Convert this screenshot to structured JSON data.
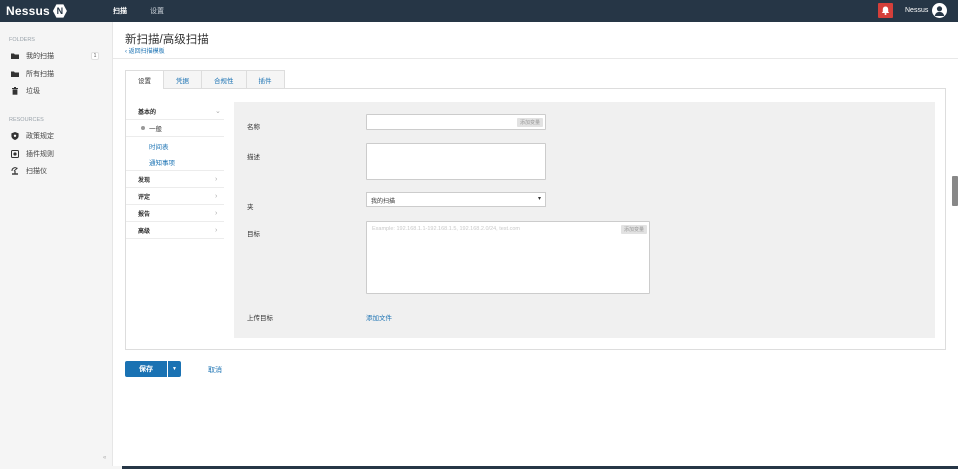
{
  "app": {
    "logo_text": "Nessus",
    "logo_badge": "N"
  },
  "topnav": {
    "scans": "扫描",
    "settings": "设置",
    "user": "Nessus"
  },
  "sidebar": {
    "section_folders": "FOLDERS",
    "folders": [
      {
        "label": "我的扫描",
        "count": "1",
        "icon": "folder-icon"
      },
      {
        "label": "所有扫描",
        "icon": "folder-icon"
      },
      {
        "label": "垃圾",
        "icon": "trash-icon"
      }
    ],
    "section_resources": "RESOURCES",
    "resources": [
      {
        "label": "政策规定",
        "icon": "shield-icon"
      },
      {
        "label": "插件规则",
        "icon": "plugin-rules-icon"
      },
      {
        "label": "扫描仪",
        "icon": "scanner-icon"
      }
    ]
  },
  "page": {
    "title": "新扫描/高级扫描",
    "back_link": "返回扫描模板"
  },
  "tabs": [
    {
      "label": "设置",
      "active": true
    },
    {
      "label": "凭据"
    },
    {
      "label": "合规性"
    },
    {
      "label": "插件"
    }
  ],
  "settings_menu": {
    "basic": "基本的",
    "basic_items": [
      "一般",
      "时间表",
      "通知事项"
    ],
    "discovery": "发现",
    "assessment": "评定",
    "report": "报告",
    "advanced": "高级"
  },
  "form": {
    "name_label": "名称",
    "description_label": "描述",
    "folder_label": "夹",
    "folder_value": "我的扫描",
    "targets_label": "目标",
    "targets_placeholder": "Example: 192.168.1.1-192.168.1.5, 192.168.2.0/24, test.com",
    "upload_label": "上传目标",
    "add_file": "添加文件",
    "variable_button": "添加变量"
  },
  "actions": {
    "save": "保存",
    "cancel": "取消"
  }
}
